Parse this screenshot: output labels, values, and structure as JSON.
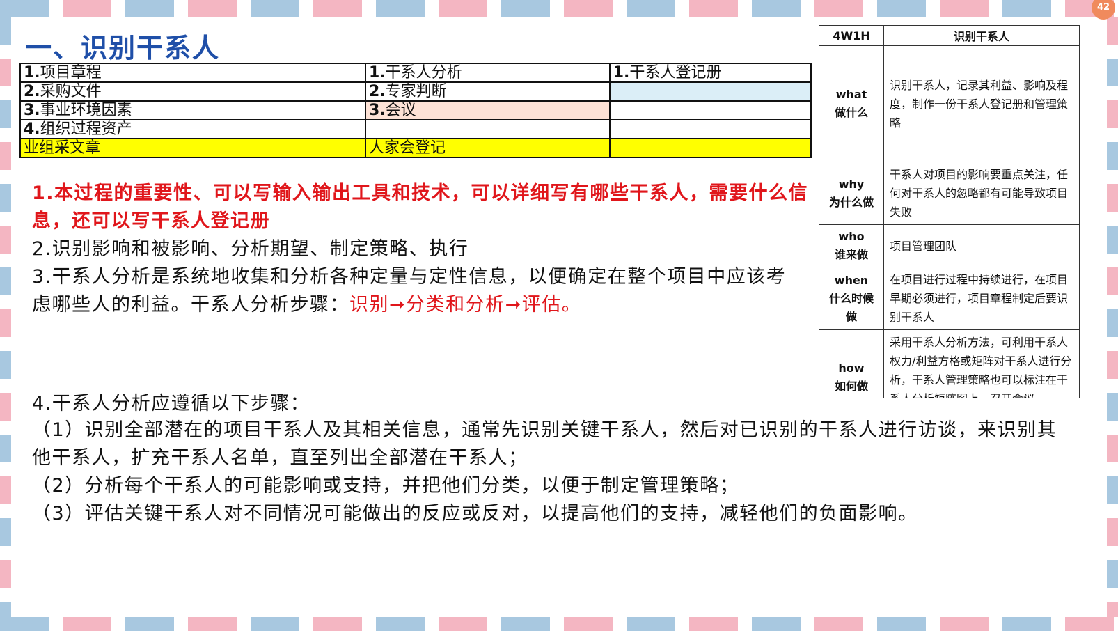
{
  "page": {
    "badge": "42"
  },
  "title": "一、识别干系人",
  "itto": {
    "rows": [
      {
        "c1_num": "1.",
        "c1": "项目章程",
        "c2_num": "1.",
        "c2": "干系人分析",
        "c3_num": "1.",
        "c3": "干系人登记册"
      },
      {
        "c1_num": "2.",
        "c1": "采购文件",
        "c2_num": "2.",
        "c2": "专家判断",
        "c3_num": "",
        "c3": ""
      },
      {
        "c1_num": "3.",
        "c1": "事业环境因素",
        "c2_num": "3.",
        "c2": "会议",
        "c3_num": "",
        "c3": ""
      },
      {
        "c1_num": "4.",
        "c1": "组织过程资产",
        "c2_num": "",
        "c2": "",
        "c3_num": "",
        "c3": ""
      },
      {
        "c1_num": "",
        "c1": "业组采文章",
        "c2_num": "",
        "c2": "人家会登记",
        "c3_num": "",
        "c3": ""
      }
    ]
  },
  "w4h": {
    "head_q": "4W1H",
    "head_a": "识别干系人",
    "rows": [
      {
        "q1": "what",
        "q2": "做什么",
        "a": "识别干系人，记录其利益、影响及程度，制作一份干系人登记册和管理策略"
      },
      {
        "q1": "why",
        "q2": "为什么做",
        "a": "干系人对项目的影响要重点关注，任何对干系人的忽略都有可能导致项目失败"
      },
      {
        "q1": "who",
        "q2": "谁来做",
        "a": "项目管理团队"
      },
      {
        "q1": "when",
        "q2": "什么时候",
        "q3": "做",
        "a": "在项目进行过程中持续进行，在项目早期必须进行，项目章程制定后要识别干系人"
      },
      {
        "q1": "how",
        "q2": "如何做",
        "a": "采用干系人分析方法，可利用干系人权力/利益方格或矩阵对干系人进行分析，干系人管理策略也可以标注在干系人分析矩阵图上，召开会议"
      }
    ]
  },
  "body": {
    "p1": "1.本过程的重要性、可以写输入输出工具和技术，可以详细写有哪些干系人，需要什么信息，还可以写干系人登记册",
    "p2": "2.识别影响和被影响、分析期望、制定策略、执行",
    "p3_a": "3.干系人分析是系统地收集和分析各种定量与定性信息，以便确定在整个项目中应该考虑哪些人的利益。干系人分析步骤：",
    "p3_b": "识别➞分类和分析➞评估。",
    "p4": "4.干系人分析应遵循以下步骤：",
    "p5": "（1）识别全部潜在的项目干系人及其相关信息，通常先识别关键干系人，然后对已识别的干系人进行访谈，来识别其他干系人，扩充干系人名单，直至列出全部潜在干系人；",
    "p6": "（2）分析每个干系人的可能影响或支持，并把他们分类，以便于制定管理策略；",
    "p7": "（3）评估关键干系人对不同情况可能做出的反应或反对，以提高他们的支持，减轻他们的负面影响。"
  }
}
